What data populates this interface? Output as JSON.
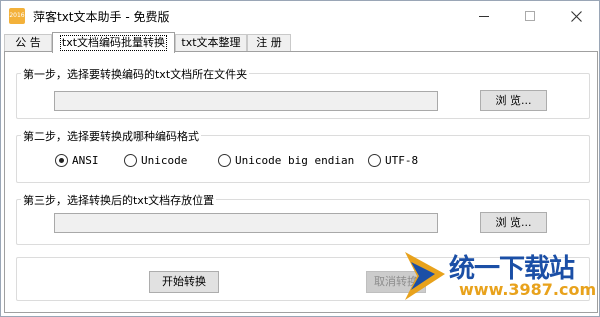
{
  "window": {
    "icon_text": "2016",
    "title": "萍客txt文本助手 - 免费版"
  },
  "tabs": [
    {
      "label": "公 告",
      "active": false
    },
    {
      "label": "txt文档编码批量转换",
      "active": true
    },
    {
      "label": "txt文本整理",
      "active": false
    },
    {
      "label": "注 册",
      "active": false
    }
  ],
  "step1": {
    "legend": "第一步，选择要转换编码的txt文档所在文件夹",
    "path_value": "",
    "browse_label": "浏 览..."
  },
  "step2": {
    "legend": "第二步，选择要转换成哪种编码格式",
    "options": [
      {
        "label": "ANSI",
        "checked": true
      },
      {
        "label": "Unicode",
        "checked": false
      },
      {
        "label": "Unicode big endian",
        "checked": false
      },
      {
        "label": "UTF-8",
        "checked": false
      }
    ]
  },
  "step3": {
    "legend": "第三步，选择转换后的txt文档存放位置",
    "path_value": "",
    "browse_label": "浏 览..."
  },
  "actions": {
    "start_label": "开始转换",
    "cancel_label": "取消转换",
    "cancel_enabled": false
  },
  "watermark": {
    "title": "统一下载站",
    "url": "www.3987.com",
    "primary_color": "#1b4fa6",
    "accent_color": "#e8a21c"
  }
}
